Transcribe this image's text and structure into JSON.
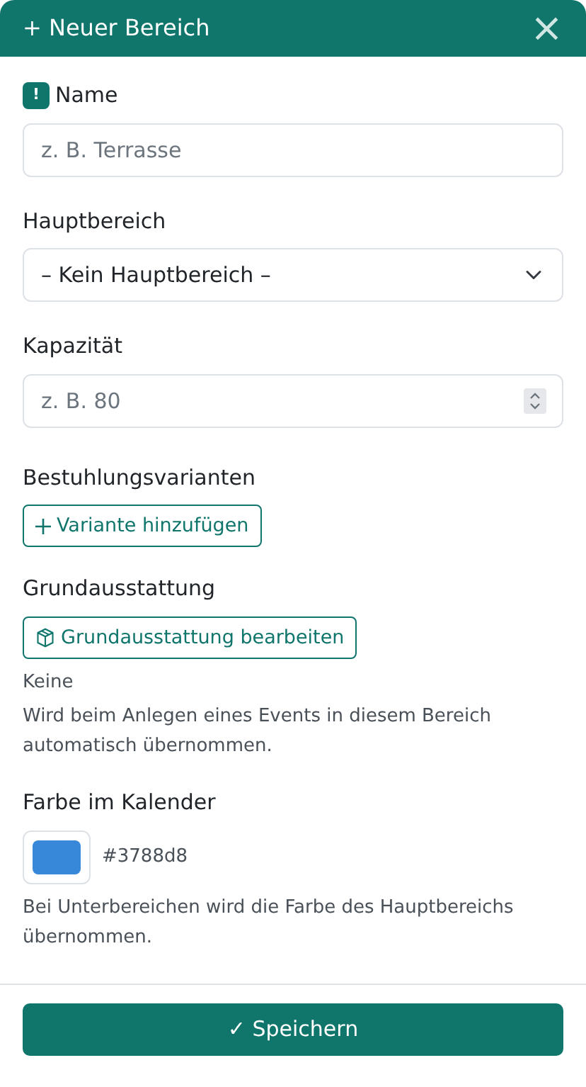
{
  "header": {
    "icon_text": "+",
    "title": "Neuer Bereich",
    "close": "×"
  },
  "name_field": {
    "required_mark": "!",
    "label": "Name",
    "placeholder": "z. B. Terrasse"
  },
  "parent_field": {
    "label": "Hauptbereich",
    "value": "– Kein Hauptbereich –"
  },
  "capacity_field": {
    "label": "Kapazität",
    "placeholder": "z. B. 80"
  },
  "seating": {
    "label": "Bestuhlungsvarianten",
    "button": "Variante hinzufügen"
  },
  "equipment": {
    "label": "Grundausstattung",
    "button": "Grundausstattung bearbeiten",
    "value": "Keine",
    "help": "Wird beim Anlegen eines Events in diesem Bereich automatisch übernommen."
  },
  "calendar_color": {
    "label": "Farbe im Kalender",
    "value": "#3788d8",
    "help": "Bei Unterbereichen wird die Farbe des Hauptbereichs übernommen."
  },
  "save_button": {
    "icon_text": "✓",
    "label": "Speichern"
  }
}
